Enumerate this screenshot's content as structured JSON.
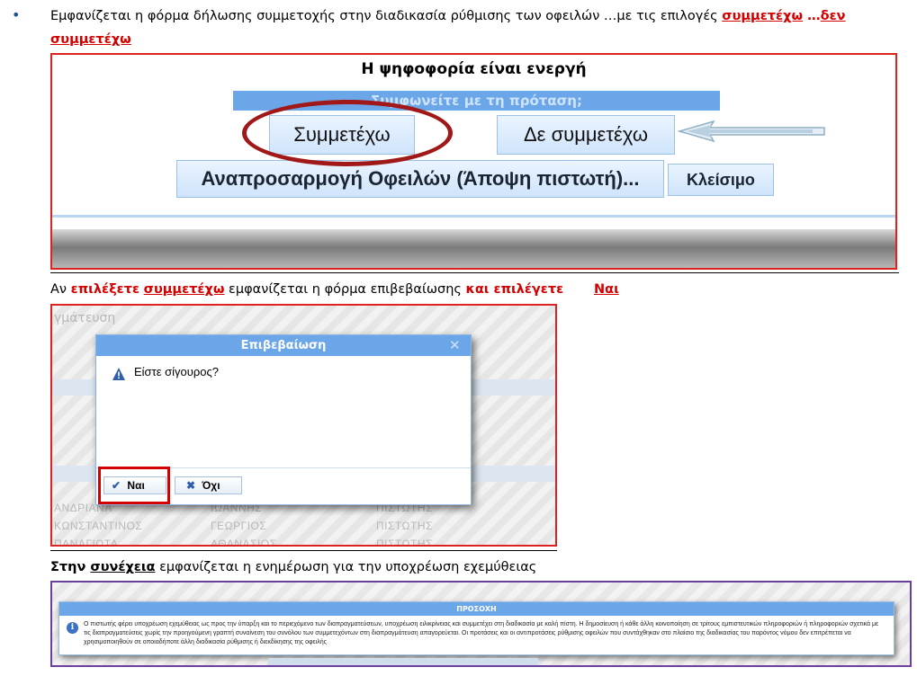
{
  "intro": {
    "bullet": "•",
    "text": "Εμφανίζεται η φόρμα δήλωσης συμμετοχής στην διαδικασία ρύθμισης των οφειλών …με τις επιλογές ",
    "option1": "συμμετέχω",
    "dots": " …",
    "option2_line1": "δεν",
    "option2_line2": "συμμετέχω"
  },
  "screen1": {
    "title": "Η ψηφοφορία είναι ενεργή",
    "question": "Συμφωνείτε με τη πρόταση;",
    "participate": "Συμμετέχω",
    "not_participate": "Δε συμμετέχω",
    "adjust": "Αναπροσαρμογή Οφειλών (Άποψη πιστωτή)...",
    "close": "Κλείσιμο"
  },
  "step2": {
    "prefix": "Αν ",
    "choose": "επιλέξετε",
    "option": "συμμετέχω",
    "middle": " εμφανίζεται η φόρμα επιβεβαίωσης ",
    "and_choose": "και επιλέγετε",
    "yes": "Ναι"
  },
  "screen2": {
    "bg_header": "γμάτευση",
    "bg_rows": [
      [
        "ΑΝΔΡΙΑΝΑ",
        "ΙΩΑΝΝΗΣ",
        "ΠΙΣΤΩΤΗΣ"
      ],
      [
        "ΚΩΝΣΤΑΝΤΙΝΟΣ",
        "ΓΕΩΡΓΙΟΣ",
        "ΠΙΣΤΩΤΗΣ"
      ],
      [
        "ΠΑΝΑΓΙΩΤΑ",
        "ΑΘΑΝΑΣΙΟΣ",
        "ΠΙΣΤΩΤΗΣ"
      ]
    ],
    "dialog_title": "Επιβεβαίωση",
    "dialog_close": "✕",
    "message": "Είστε σίγουρος?",
    "yes_label": "Ναι",
    "no_label": "Όχι",
    "yes_icon": "check-icon",
    "no_icon": "cross-icon"
  },
  "step3": {
    "prefix": "Στην ",
    "next": "συνέχεια",
    "rest": " εμφανίζεται η ενημέρωση για την υποχρέωση εχεμύθειας"
  },
  "screen3": {
    "title": "ΠΡΟΣΟΧΗ",
    "text": "Ο πιστωτής φέρει υποχρέωση εχεμύθειας ως προς την ύπαρξη και το περιεχόμενο των διαπραγματεύσεων, υποχρέωση ειλικρίνειας και συμμετέχει στη διαδικασία με καλή πίστη. Η δημοσίευση ή κάθε άλλη κοινοποίηση σε τρίτους εμπιστευτικών πληροφοριών ή πληροφοριών σχετικά με τις διαπραγματεύσεις χωρίς την προηγούμενη γραπτή συναίνεση του συνόλου των συμμετεχόντων στη διαπραγμάτευση απαγορεύεται. Οι προτάσεις και οι αντιπροτάσεις ρύθμισης οφειλών που συντάχθηκαν στο πλαίσιο της διαδικασίας του παρόντος νόμου δεν επιτρέπεται να χρησιμοποιηθούν σε οποιαδήποτε άλλη διαδικασία ρύθμισης ή διεκδίκησης της οφειλής"
  },
  "colors": {
    "accent_red": "#d40000",
    "dialog_blue": "#6aa6e8",
    "frame_purple": "#6a3fa0"
  }
}
